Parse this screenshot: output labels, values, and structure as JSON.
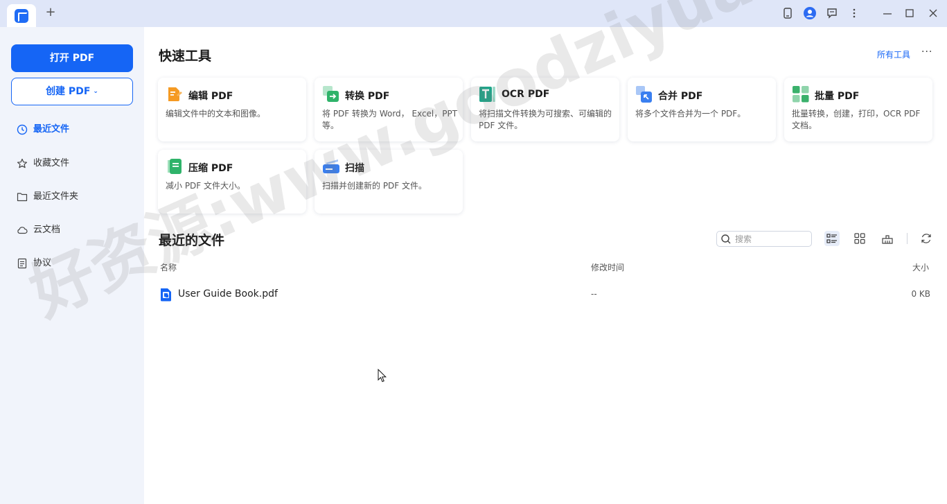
{
  "titlebar": {
    "new_tab_symbol": "+",
    "icons": [
      "tablet-icon",
      "account-icon",
      "feedback-icon",
      "more-vertical-icon",
      "minimize-icon",
      "maximize-icon",
      "close-icon"
    ]
  },
  "sidebar": {
    "open_pdf": "打开 PDF",
    "create_pdf": "创建 PDF",
    "create_caret": "⌄",
    "items": [
      {
        "label": "最近文件",
        "icon": "clock-icon",
        "active": true
      },
      {
        "label": "收藏文件",
        "icon": "star-icon",
        "active": false
      },
      {
        "label": "最近文件夹",
        "icon": "folder-icon",
        "active": false
      },
      {
        "label": "云文档",
        "icon": "cloud-icon",
        "active": false
      },
      {
        "label": "协议",
        "icon": "document-icon",
        "active": false
      }
    ]
  },
  "quick_tools": {
    "title": "快速工具",
    "all_tools": "所有工具",
    "more": "···",
    "cards": [
      {
        "title": "编辑 PDF",
        "desc": "编辑文件中的文本和图像。",
        "icon": "edit-pdf-icon",
        "color": "#f59a23"
      },
      {
        "title": "转换 PDF",
        "desc": "将 PDF 转换为 Word， Excel，PPT等。",
        "icon": "convert-pdf-icon",
        "color": "#2fb36a"
      },
      {
        "title": "OCR PDF",
        "desc": "将扫描文件转换为可搜索、可编辑的 PDF 文件。",
        "icon": "ocr-pdf-icon",
        "color": "#1fa58a"
      },
      {
        "title": "合并 PDF",
        "desc": "将多个文件合并为一个 PDF。",
        "icon": "combine-pdf-icon",
        "color": "#3a7ff0"
      },
      {
        "title": "批量 PDF",
        "desc": "批量转换，创建，打印，OCR PDF 文档。",
        "icon": "batch-pdf-icon",
        "color": "#3bb16c"
      },
      {
        "title": "压缩 PDF",
        "desc": "减小 PDF 文件大小。",
        "icon": "compress-pdf-icon",
        "color": "#2fb36a"
      },
      {
        "title": "扫描",
        "desc": "扫描并创建新的 PDF 文件。",
        "icon": "scan-icon",
        "color": "#3a7ff0"
      }
    ]
  },
  "recent": {
    "title": "最近的文件",
    "search_placeholder": "搜索",
    "columns": {
      "name": "名称",
      "modified": "修改时间",
      "size": "大小"
    },
    "files": [
      {
        "name": "User Guide Book.pdf",
        "modified": "--",
        "size": "0 KB"
      }
    ]
  },
  "watermark": "好资源:www.goodziyuan.com",
  "colors": {
    "accent": "#1565f5",
    "sidebar_bg": "#f1f4fb",
    "titlebar_bg": "#dfe6f8"
  }
}
